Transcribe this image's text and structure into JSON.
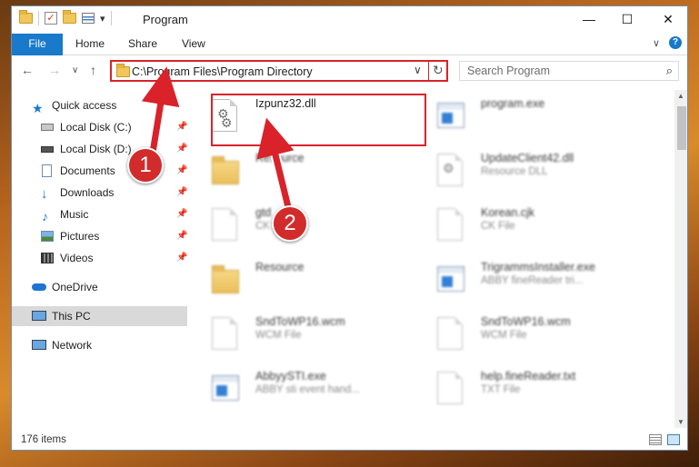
{
  "window": {
    "title": "Program",
    "minimize": "—",
    "maximize": "☐",
    "close": "✕",
    "qat_dropdown": "▾"
  },
  "ribbon": {
    "file": "File",
    "tabs": [
      "Home",
      "Share",
      "View"
    ],
    "expand": "∨",
    "help": "?"
  },
  "nav": {
    "back": "←",
    "forward": "→",
    "recent": "∨",
    "up": "↑"
  },
  "address": {
    "path": "C:\\Program Files\\Program Directory",
    "chevron": "∨",
    "refresh": "↻"
  },
  "search": {
    "placeholder": "Search Program",
    "icon": "⌕"
  },
  "sidebar": {
    "quick_access": "Quick access",
    "items": [
      {
        "label": "Local Disk (C:)",
        "icon": "drive-icon",
        "pinned": true
      },
      {
        "label": "Local Disk (D:)",
        "icon": "drive-icon",
        "pinned": true
      },
      {
        "label": "Documents",
        "icon": "documents-icon",
        "pinned": true
      },
      {
        "label": "Downloads",
        "icon": "downloads-icon",
        "pinned": true
      },
      {
        "label": "Music",
        "icon": "music-icon",
        "pinned": true
      },
      {
        "label": "Pictures",
        "icon": "pictures-icon",
        "pinned": true
      },
      {
        "label": "Videos",
        "icon": "videos-icon",
        "pinned": true
      }
    ],
    "onedrive": "OneDrive",
    "this_pc": "This PC",
    "network": "Network",
    "pin_glyph": "📌"
  },
  "files": [
    {
      "name": "Izpunz32.dll",
      "type": "",
      "icon": "dll-icon",
      "highlighted": true
    },
    {
      "name": "program.exe",
      "type": "",
      "icon": "exe-icon"
    },
    {
      "name": "Resource",
      "type": "",
      "icon": "folder-icon"
    },
    {
      "name": "UpdateClient42.dll",
      "type": "Resource DLL",
      "icon": "dll-icon"
    },
    {
      "name": "gtd",
      "type": "CK",
      "icon": "document-icon"
    },
    {
      "name": "Korean.cjk",
      "type": "CK File",
      "icon": "document-icon"
    },
    {
      "name": "Resource",
      "type": "",
      "icon": "folder-icon"
    },
    {
      "name": "TrigrammsInstaller.exe",
      "type": "ABBY fineReader tri...",
      "icon": "exe-icon"
    },
    {
      "name": "SndToWP16.wcm",
      "type": "WCM File",
      "icon": "document-icon"
    },
    {
      "name": "SndToWP16.wcm",
      "type": "WCM File",
      "icon": "document-icon"
    },
    {
      "name": "AbbyySTI.exe",
      "type": "ABBY sti event hand...",
      "icon": "exe-icon"
    },
    {
      "name": "help.fineReader.txt",
      "type": "TXT File",
      "icon": "document-icon"
    }
  ],
  "status": {
    "item_count": "176 items"
  },
  "annotations": {
    "step1": "1",
    "step2": "2",
    "color": "#d9222a"
  },
  "colors": {
    "accent": "#1979ca",
    "selection": "#d9d9d9",
    "highlight": "#d9222a"
  }
}
